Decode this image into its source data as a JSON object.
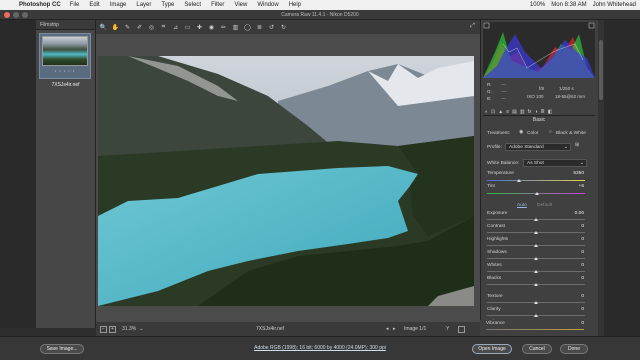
{
  "menubar": {
    "app": "Photoshop CC",
    "items": [
      "File",
      "Edit",
      "Image",
      "Layer",
      "Type",
      "Select",
      "Filter",
      "View",
      "Window",
      "Help"
    ],
    "battery": "100%",
    "clock": "Mon 8:38 AM",
    "user": "John Whitehead"
  },
  "titlebar": {
    "title": "Camera Raw 11.4.1  -  Nikon D5200"
  },
  "filmstrip": {
    "header": "Filmstrip",
    "stars": "• • • • •",
    "filename": "7XSJs4ir.nef"
  },
  "status": {
    "zoom": "31.3%",
    "filename": "7XSJs4ir.nef",
    "image_counter": "Image 1/1"
  },
  "exif": {
    "r": "R:",
    "g": "G:",
    "b": "B:",
    "r_val": "---",
    "g_val": "---",
    "b_val": "---",
    "aperture": "f/8",
    "shutter": "1/250 s",
    "iso": "ISO 100",
    "lens": "18-55@62 mm"
  },
  "panel": {
    "title": "Basic",
    "treatment_label": "Treatment:",
    "treatment_color": "Color",
    "treatment_bw": "Black & White",
    "profile_label": "Profile:",
    "profile_value": "Adobe Standard",
    "wb_label": "White Balance:",
    "wb_value": "As Shot",
    "auto": "Auto",
    "default": "Default",
    "sliders": [
      {
        "label": "Temperature",
        "value": "5350"
      },
      {
        "label": "Tint",
        "value": "+6"
      },
      {
        "label": "Exposure",
        "value": "0.00"
      },
      {
        "label": "Contrast",
        "value": "0"
      },
      {
        "label": "Highlights",
        "value": "0"
      },
      {
        "label": "Shadows",
        "value": "0"
      },
      {
        "label": "Whites",
        "value": "0"
      },
      {
        "label": "Blacks",
        "value": "0"
      },
      {
        "label": "Texture",
        "value": "0"
      },
      {
        "label": "Clarity",
        "value": "0"
      },
      {
        "label": "Dehaze",
        "value": "0"
      },
      {
        "label": "Vibrance",
        "value": "0"
      }
    ]
  },
  "footer": {
    "save": "Save Image...",
    "workflow": "Adobe RGB (1998); 16 bit; 6000 by 4000 (24.0MP); 300 ppi",
    "open": "Open Image",
    "cancel": "Cancel",
    "done": "Done"
  }
}
